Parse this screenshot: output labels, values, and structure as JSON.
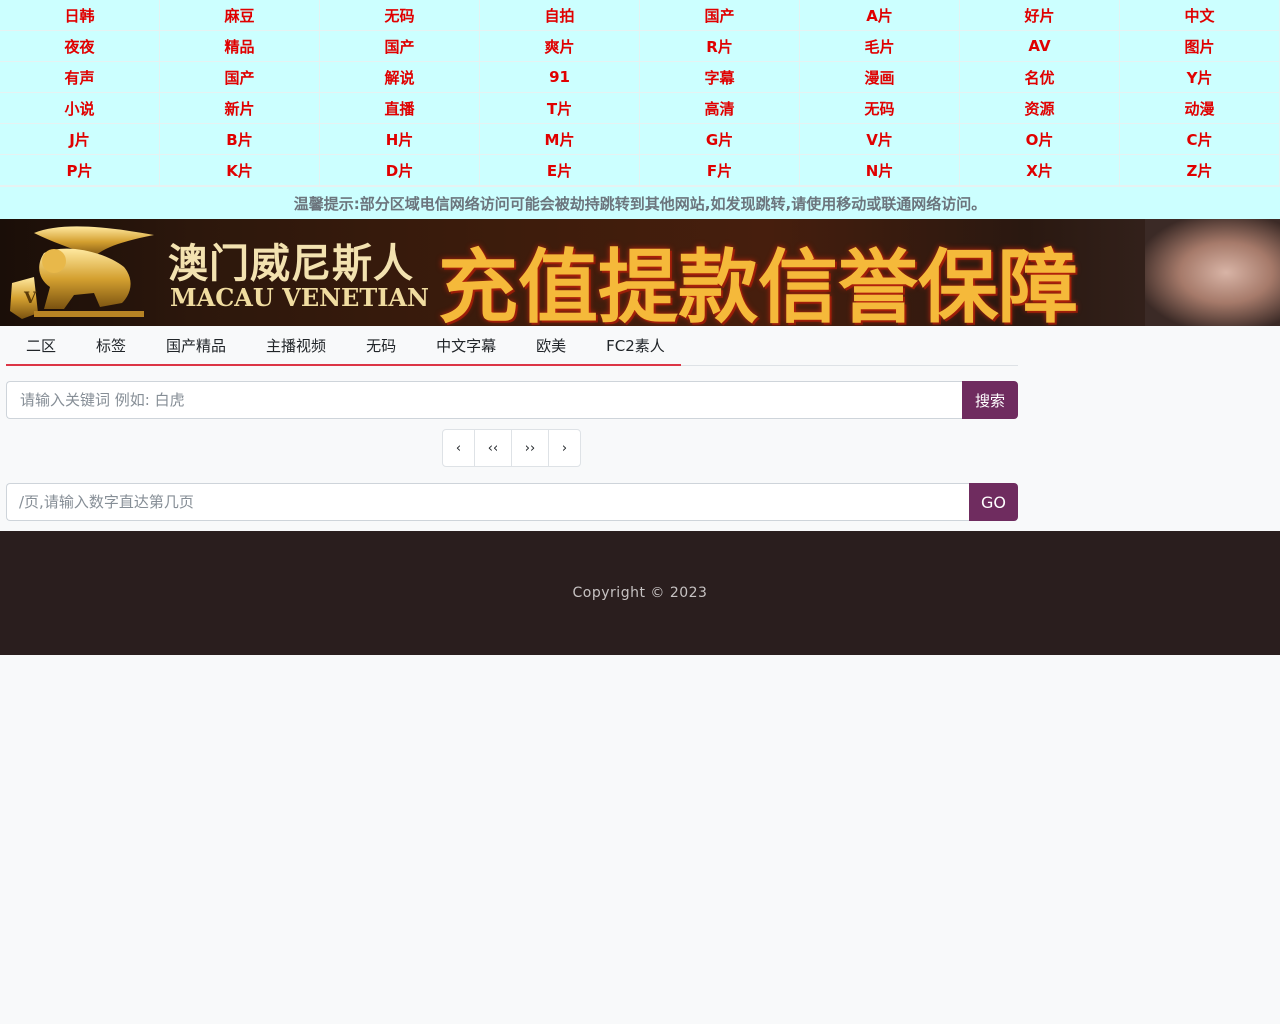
{
  "nav": {
    "items": [
      "日韩",
      "麻豆",
      "无码",
      "自拍",
      "国产",
      "A片",
      "好片",
      "中文",
      "夜夜",
      "精品",
      "国产",
      "爽片",
      "R片",
      "毛片",
      "AV",
      "图片",
      "有声",
      "国产",
      "解说",
      "91",
      "字幕",
      "漫画",
      "名优",
      "Y片",
      "小说",
      "新片",
      "直播",
      "T片",
      "高清",
      "无码",
      "资源",
      "动漫",
      "J片",
      "B片",
      "H片",
      "M片",
      "G片",
      "V片",
      "O片",
      "C片",
      "P片",
      "K片",
      "D片",
      "E片",
      "F片",
      "N片",
      "X片",
      "Z片"
    ]
  },
  "notice": "温馨提示:部分区域电信网络访问可能会被劫持跳转到其他网站,如发现跳转,请使用移动或联通网络访问。",
  "banner": {
    "cn_title": "澳门威尼斯人",
    "en_title": "MACAU VENETIAN",
    "slogan": "充值提款信誉保障"
  },
  "tabs": [
    "二区",
    "标签",
    "国产精品",
    "主播视频",
    "无码",
    "中文字幕",
    "欧美",
    "FC2素人"
  ],
  "search": {
    "placeholder": "请输入关键词 例如: 白虎",
    "button": "搜索"
  },
  "pager": {
    "prev": "‹",
    "first": "‹‹",
    "last": "››",
    "next": "›"
  },
  "goto": {
    "placeholder": "/页,请输入数字直达第几页",
    "button": "GO"
  },
  "footer": {
    "copyright": "Copyright © 2023"
  },
  "colors": {
    "nav_bg": "#ccffff",
    "nav_text": "#e00000",
    "accent": "#6f2c5f",
    "tab_underline": "#dc3545",
    "footer_bg": "#2a1e1e"
  }
}
